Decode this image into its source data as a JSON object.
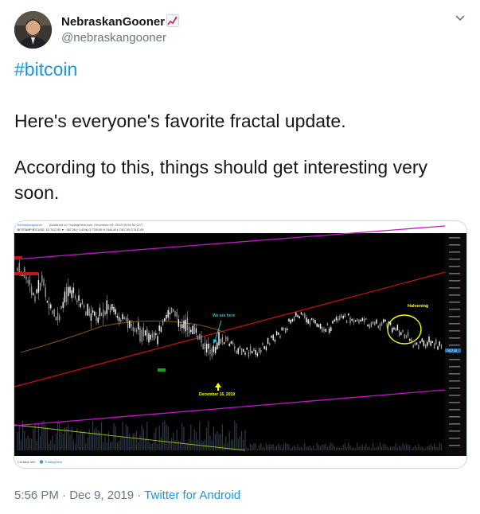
{
  "tweet": {
    "author_name": "NebraskanGooner",
    "author_handle": "@nebraskangooner",
    "hashtag": "#bitcoin",
    "paragraph1": "Here's everyone's favorite fractal update.",
    "paragraph2_line1": "According to this, things should get interesting very",
    "paragraph2_line2": "soon.",
    "time": "5:56 PM",
    "separator": " · ",
    "date": "Dec 9, 2019",
    "source": "Twitter for Android"
  },
  "icons": {
    "emoji": "chart-increasing-icon",
    "menu": "chevron-down-icon"
  },
  "chart": {
    "header_author": "nebraskangooner",
    "header_published": "published on TradingView.com, December 09, 2019 09:54:52 CST",
    "symbol_line": "BITSTAMP:BTCUSD, 1D  7417.00 ▼ −307.26 (−1.41%)  O:7730.00  H:7444.40  L:7417.00  C:7417.00",
    "annotation_we_are_here": "We are here",
    "annotation_date": "December 16, 2019",
    "annotation_halvening": "Halvening",
    "footer_text": "Created with",
    "footer_brand": "TradingView",
    "current_price_tag": "7417.00",
    "colors": {
      "background": "#000000",
      "candles": "#ffffff",
      "channel_upper": "#c218c2",
      "channel_lower": "#c218c2",
      "trend_line": "#d01010",
      "ma_line": "#7a5020",
      "annotation_yellow": "#ffff00",
      "annotation_cyan": "#1ec8c8"
    }
  }
}
